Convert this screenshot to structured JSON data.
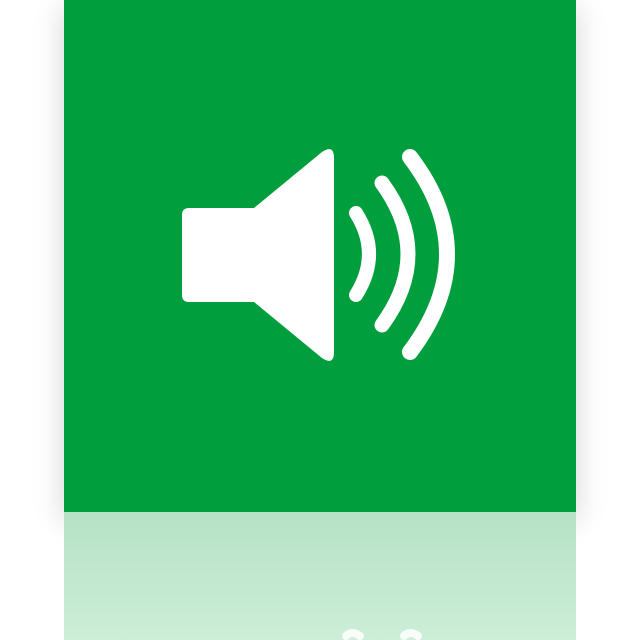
{
  "icon": {
    "name": "speaker-volume-icon",
    "tile_color": "#009e3d",
    "glyph_color": "#ffffff",
    "reflection_color": "#c4e9d1"
  }
}
